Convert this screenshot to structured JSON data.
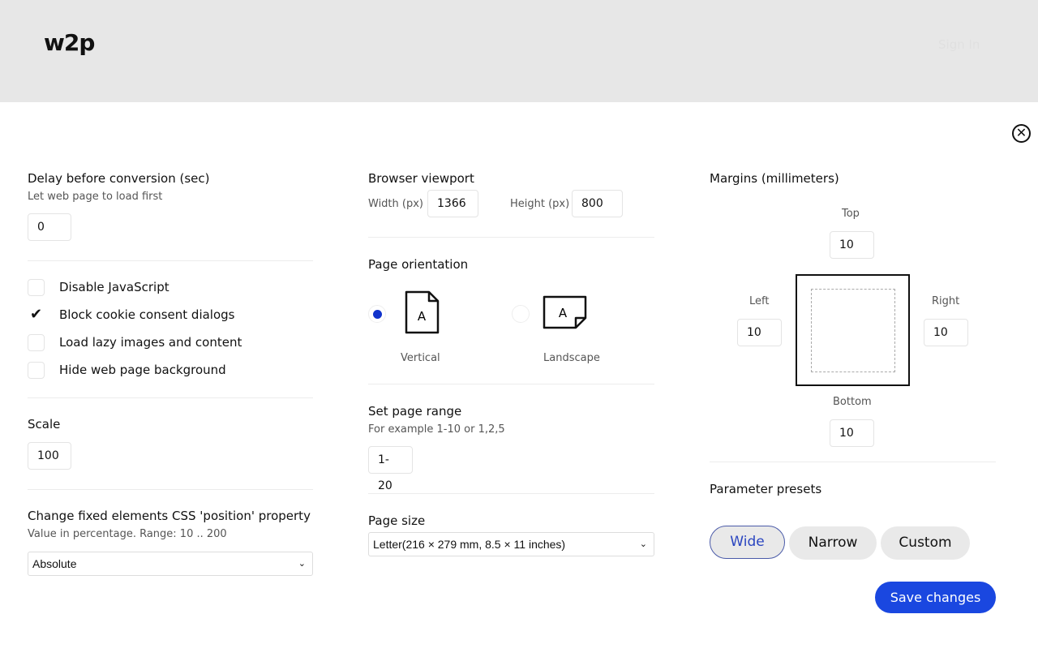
{
  "header": {
    "logo": "w2p",
    "sign_in": "Sign In"
  },
  "close_icon": "close-circle-icon",
  "delay": {
    "title": "Delay before conversion (sec)",
    "hint": "Let web page to load first",
    "value": "0"
  },
  "options": [
    {
      "label": "Disable JavaScript",
      "checked": false
    },
    {
      "label": "Block cookie consent dialogs",
      "checked": true
    },
    {
      "label": "Load lazy images and content",
      "checked": false
    },
    {
      "label": "Hide web page background",
      "checked": false
    }
  ],
  "scale": {
    "title": "Scale",
    "value": "100"
  },
  "position": {
    "title": "Change fixed elements CSS 'position' property",
    "hint": "Value in percentage. Range: 10 .. 200",
    "selected": "Absolute"
  },
  "viewport": {
    "title": "Browser viewport",
    "width_label": "Width (px)",
    "width": "1366",
    "height_label": "Height (px)",
    "height": "800"
  },
  "orientation": {
    "title": "Page orientation",
    "vertical": "Vertical",
    "landscape": "Landscape",
    "selected": "Vertical",
    "accent": "#1133cc"
  },
  "range": {
    "title": "Set page range",
    "hint": "For example 1-10 or 1,2,5",
    "value": "1-20"
  },
  "page_size": {
    "title": "Page size",
    "selected": "Letter(216 × 279 mm, 8.5 × 11 inches)"
  },
  "margins": {
    "title": "Margins (millimeters)",
    "top_label": "Top",
    "top": "10",
    "left_label": "Left",
    "left": "10",
    "right_label": "Right",
    "right": "10",
    "bottom_label": "Bottom",
    "bottom": "10"
  },
  "presets": {
    "title": "Parameter presets",
    "items": [
      "Wide",
      "Narrow",
      "Custom"
    ],
    "selected": "Wide"
  },
  "save": {
    "label": "Save changes",
    "color": "#1a47e0"
  }
}
